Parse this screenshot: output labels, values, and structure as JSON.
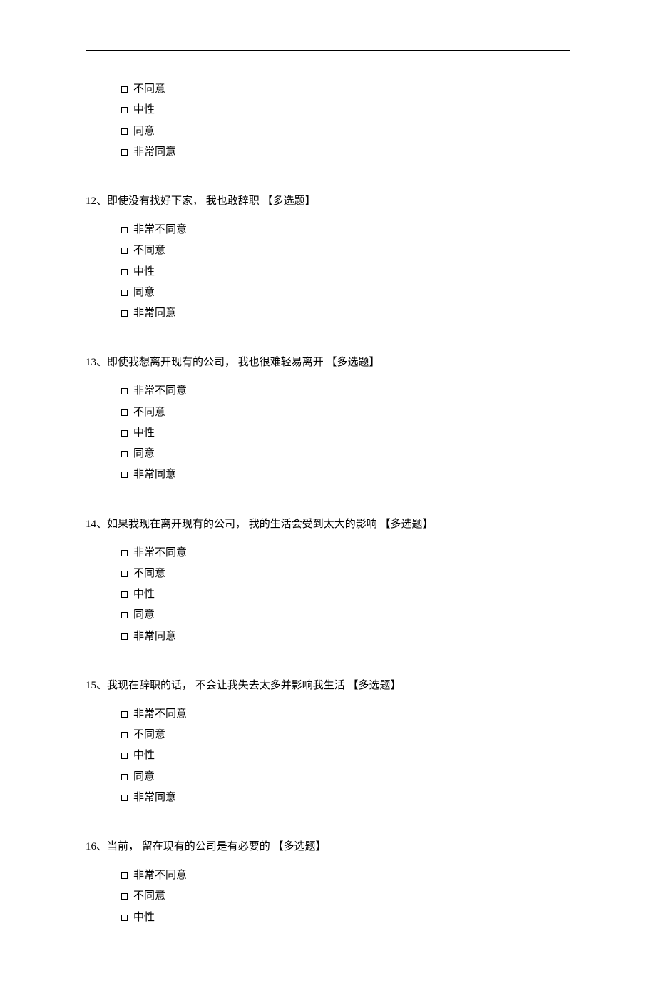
{
  "orphan_options": [
    "不同意",
    "中性",
    "同意",
    "非常同意"
  ],
  "questions": [
    {
      "number": "12、",
      "text": "即使没有找好下家，  我也敢辞职 ",
      "tag": "【多选题】",
      "options": [
        "非常不同意",
        "不同意",
        "中性",
        "同意",
        "非常同意"
      ]
    },
    {
      "number": "13、",
      "text": "即使我想离开现有的公司，  我也很难轻易离开 ",
      "tag": "【多选题】",
      "options": [
        "非常不同意",
        "不同意",
        "中性",
        "同意",
        "非常同意"
      ]
    },
    {
      "number": "14、",
      "text": "如果我现在离开现有的公司，  我的生活会受到太大的影响 ",
      "tag": "【多选题】",
      "options": [
        "非常不同意",
        "不同意",
        "中性",
        "同意",
        "非常同意"
      ]
    },
    {
      "number": "15、",
      "text": "我现在辞职的话，  不会让我失去太多并影响我生活 ",
      "tag": "【多选题】",
      "options": [
        "非常不同意",
        "不同意",
        "中性",
        "同意",
        "非常同意"
      ]
    },
    {
      "number": "16、",
      "text": "当前，  留在现有的公司是有必要的 ",
      "tag": "【多选题】",
      "options": [
        "非常不同意",
        "不同意",
        "中性"
      ]
    }
  ]
}
